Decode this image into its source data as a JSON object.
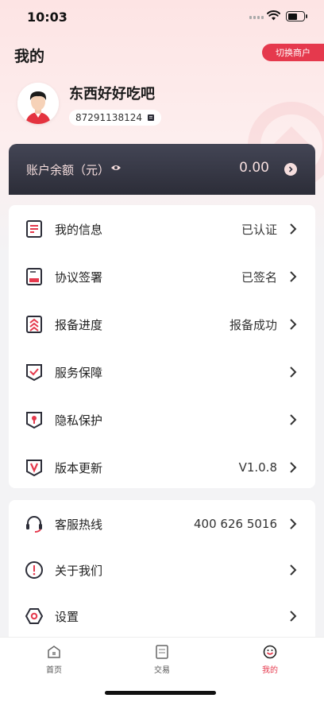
{
  "status_bar": {
    "time": "10:03"
  },
  "header": {
    "title": "我的",
    "switch_button": "切换商户"
  },
  "user": {
    "name": "东西好好吃吧",
    "id": "87291138124"
  },
  "balance": {
    "label": "账户余额（元）",
    "value": "0.00"
  },
  "menu_main": [
    {
      "label": "我的信息",
      "value": "已认证",
      "icon": "document-icon"
    },
    {
      "label": "协议签署",
      "value": "已签名",
      "icon": "agreement-icon"
    },
    {
      "label": "报备进度",
      "value": "报备成功",
      "icon": "progress-icon"
    },
    {
      "label": "服务保障",
      "value": "",
      "icon": "shield-check-icon"
    },
    {
      "label": "隐私保护",
      "value": "",
      "icon": "privacy-lock-icon"
    },
    {
      "label": "版本更新",
      "value": "V1.0.8",
      "icon": "version-icon"
    }
  ],
  "menu_support": [
    {
      "label": "客服热线",
      "value": "400 626 5016",
      "icon": "headset-icon"
    },
    {
      "label": "关于我们",
      "value": "",
      "icon": "info-icon"
    },
    {
      "label": "设置",
      "value": "",
      "icon": "settings-icon"
    }
  ],
  "tabs": [
    {
      "label": "首页",
      "icon": "home-icon"
    },
    {
      "label": "交易",
      "icon": "transaction-icon"
    },
    {
      "label": "我的",
      "icon": "profile-icon"
    }
  ],
  "colors": {
    "accent": "#e5394d",
    "balance_card": "#363845"
  }
}
